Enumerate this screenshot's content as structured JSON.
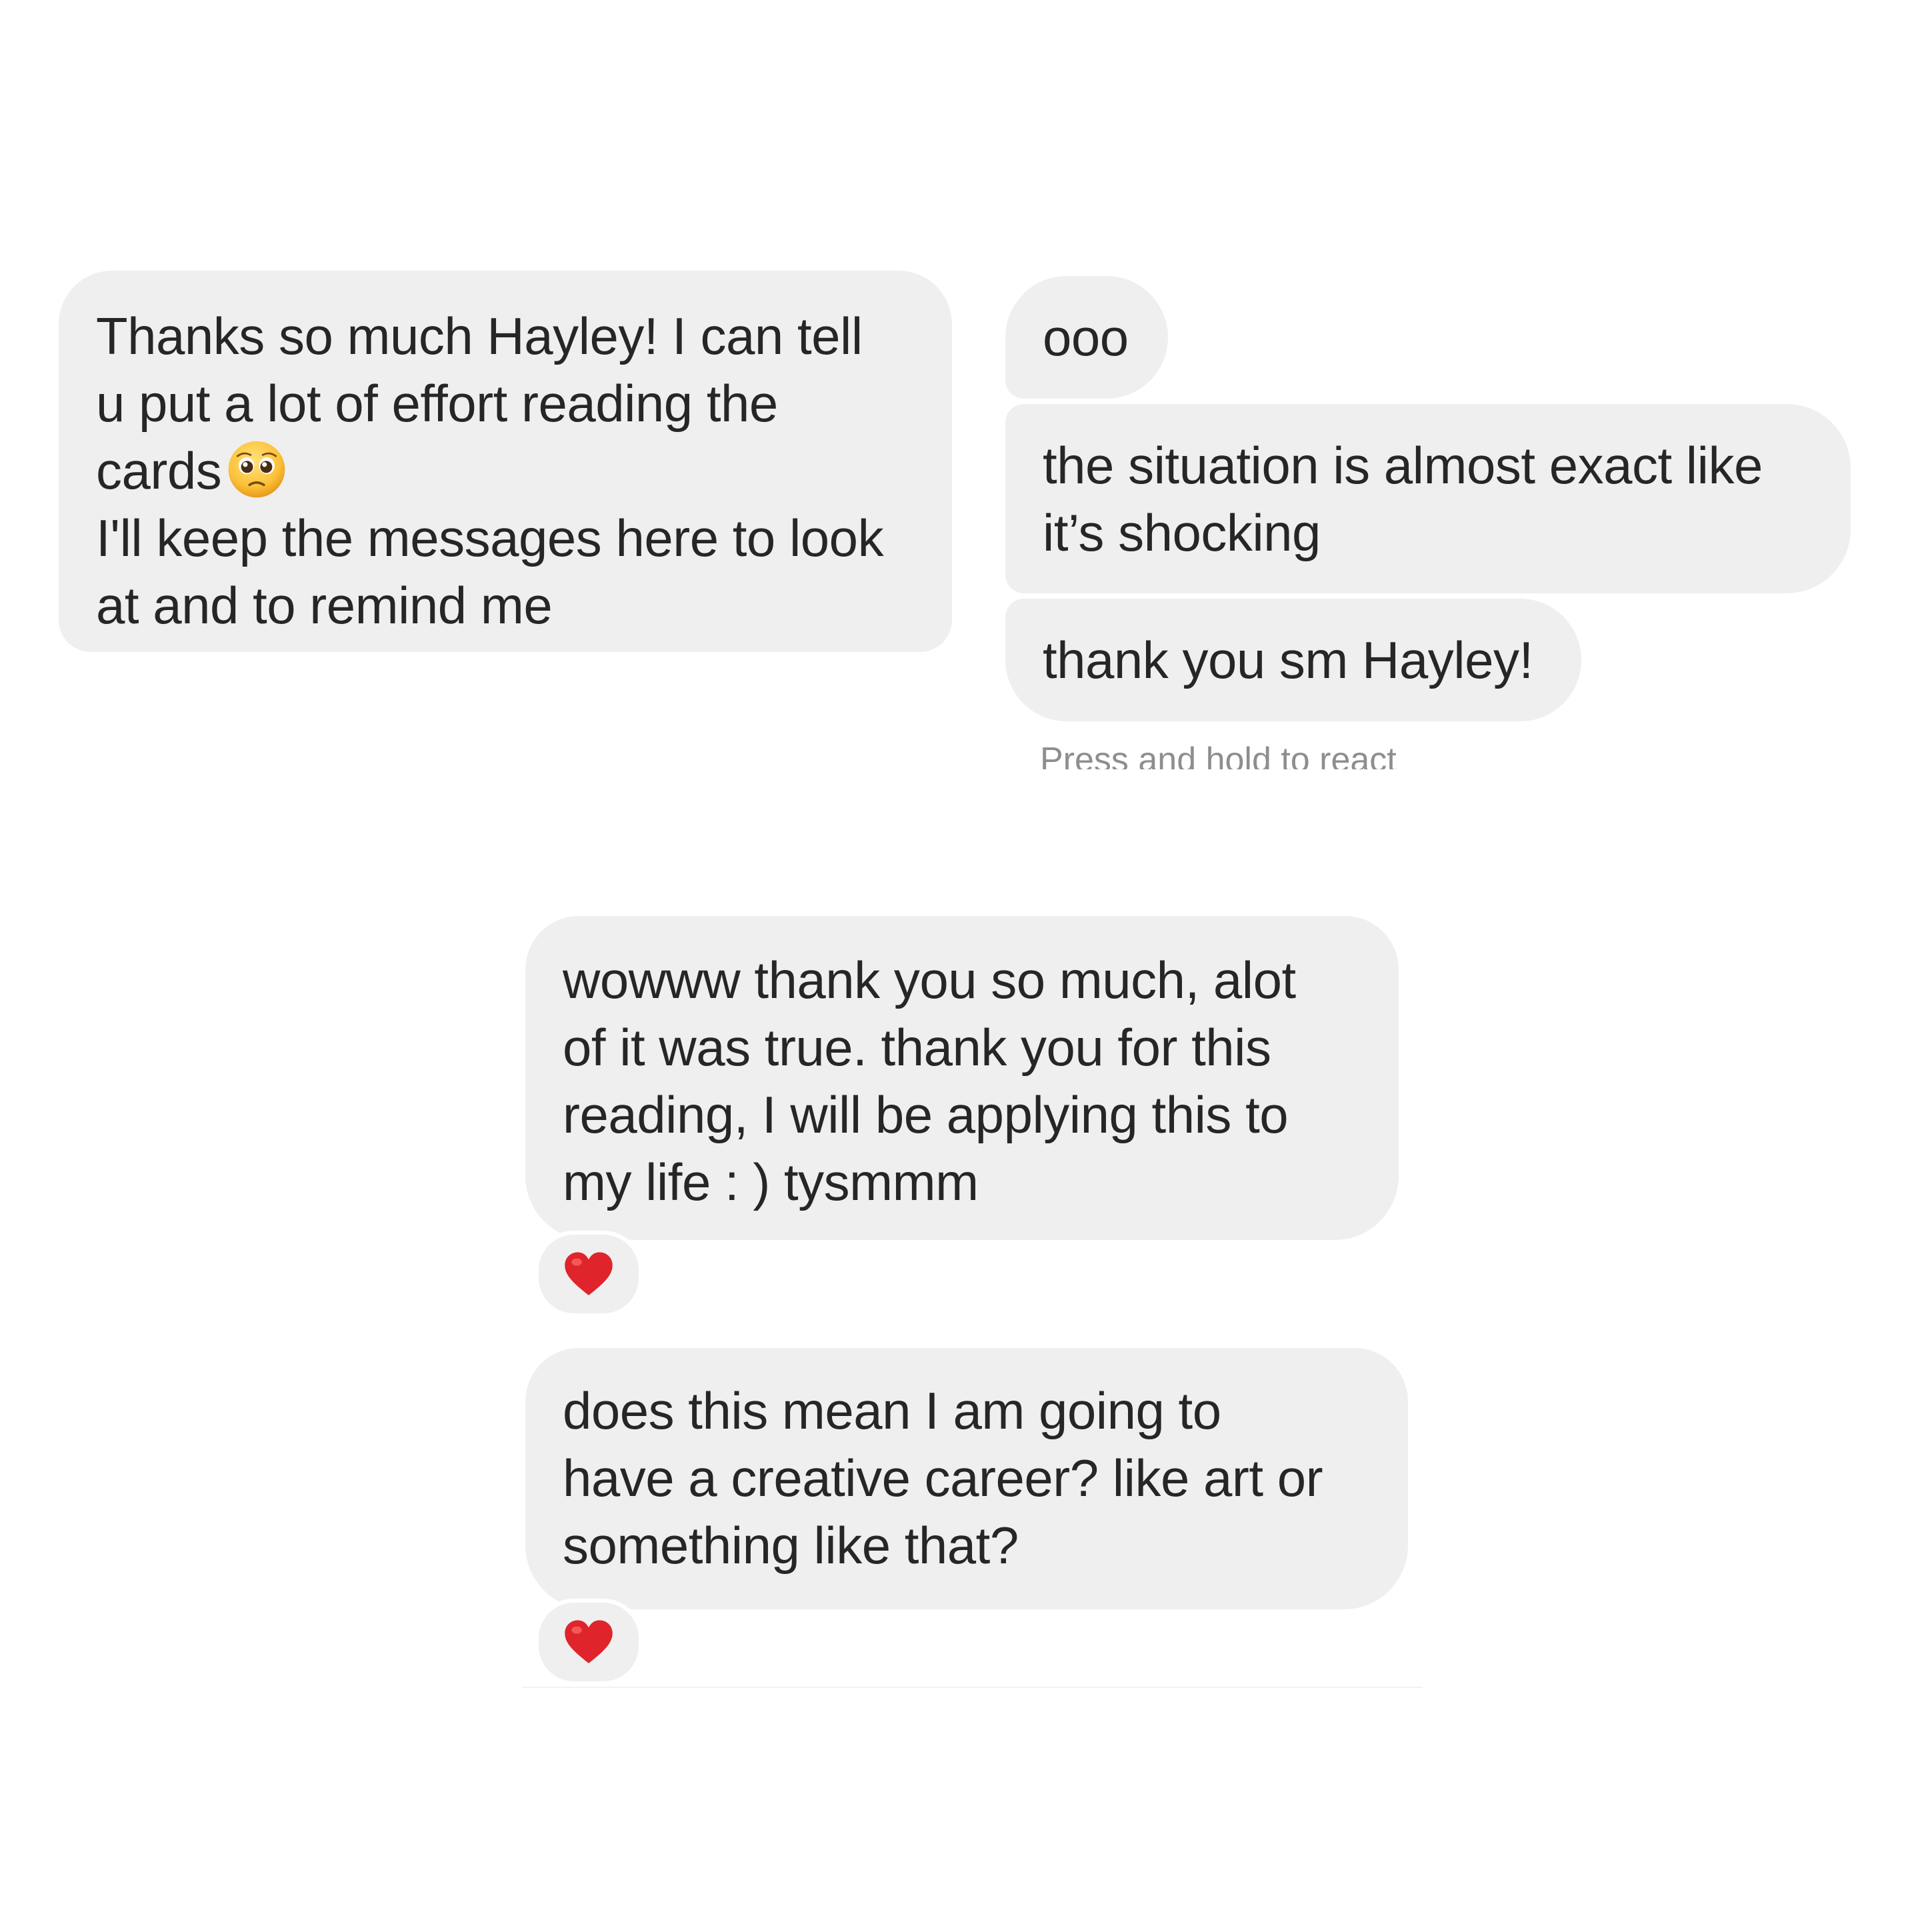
{
  "panel_top_left": {
    "message": {
      "lines": [
        "Thanks so much Hayley! I can tell",
        "u put a lot of effort reading the",
        "cards",
        "I'll keep the messages here to look",
        "at and to remind me"
      ],
      "emoji": "pleading-face-emoji"
    }
  },
  "panel_top_right": {
    "messages": [
      {
        "lines": [
          "ooo"
        ]
      },
      {
        "lines": [
          "the situation is almost exact like",
          "it’s shocking"
        ]
      },
      {
        "lines": [
          "thank you sm Hayley!"
        ]
      }
    ],
    "hint": "Press and hold to react"
  },
  "panel_bottom": {
    "messages": [
      {
        "lines": [
          "wowww thank you so much, alot",
          "of it was true. thank you for this",
          "reading, I will be applying this to",
          "my life : ) tysmmm"
        ],
        "reaction": "red-heart-emoji"
      },
      {
        "lines": [
          "does this mean I am going to",
          "have a creative career? like art or",
          "something like that?"
        ],
        "reaction": "red-heart-emoji"
      }
    ]
  },
  "colors": {
    "bubble": "#efefef",
    "text": "#262626",
    "hint": "#8e8e8e",
    "heart": "#e0242b"
  }
}
